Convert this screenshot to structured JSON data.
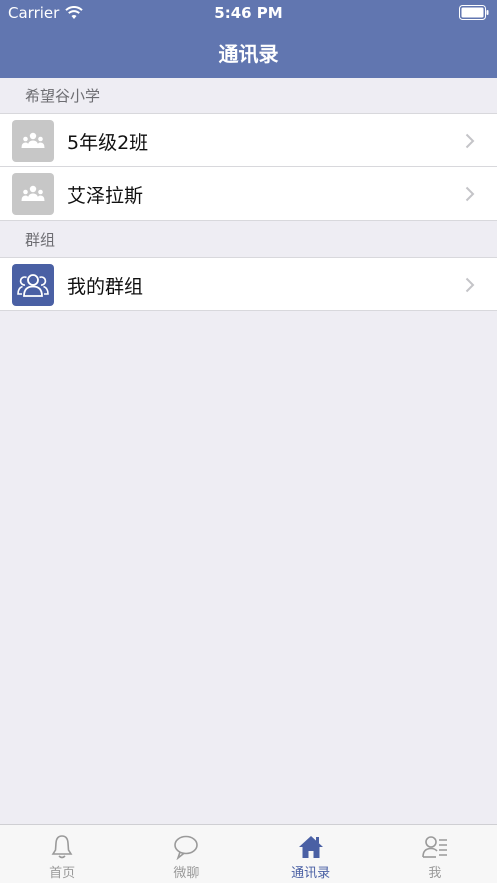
{
  "status_bar": {
    "carrier": "Carrier",
    "time": "5:46 PM"
  },
  "nav": {
    "title": "通讯录"
  },
  "sections": [
    {
      "header": "希望谷小学",
      "items": [
        {
          "label": "5年级2班",
          "icon": "group-icon"
        },
        {
          "label": "艾泽拉斯",
          "icon": "group-icon"
        }
      ]
    },
    {
      "header": "群组",
      "items": [
        {
          "label": "我的群组",
          "icon": "people-group-icon"
        }
      ]
    }
  ],
  "tabbar": {
    "tabs": [
      {
        "label": "首页",
        "icon": "bell-icon",
        "active": false
      },
      {
        "label": "微聊",
        "icon": "chat-bubble-icon",
        "active": false
      },
      {
        "label": "通讯录",
        "icon": "house-icon",
        "active": true
      },
      {
        "label": "我",
        "icon": "profile-list-icon",
        "active": false
      }
    ]
  },
  "colors": {
    "nav_background": "#6176b0",
    "accent": "#4a60a4",
    "page_background": "#eeedf3",
    "avatar_grey": "#c7c7c7",
    "tab_inactive": "#9a9a9a"
  }
}
